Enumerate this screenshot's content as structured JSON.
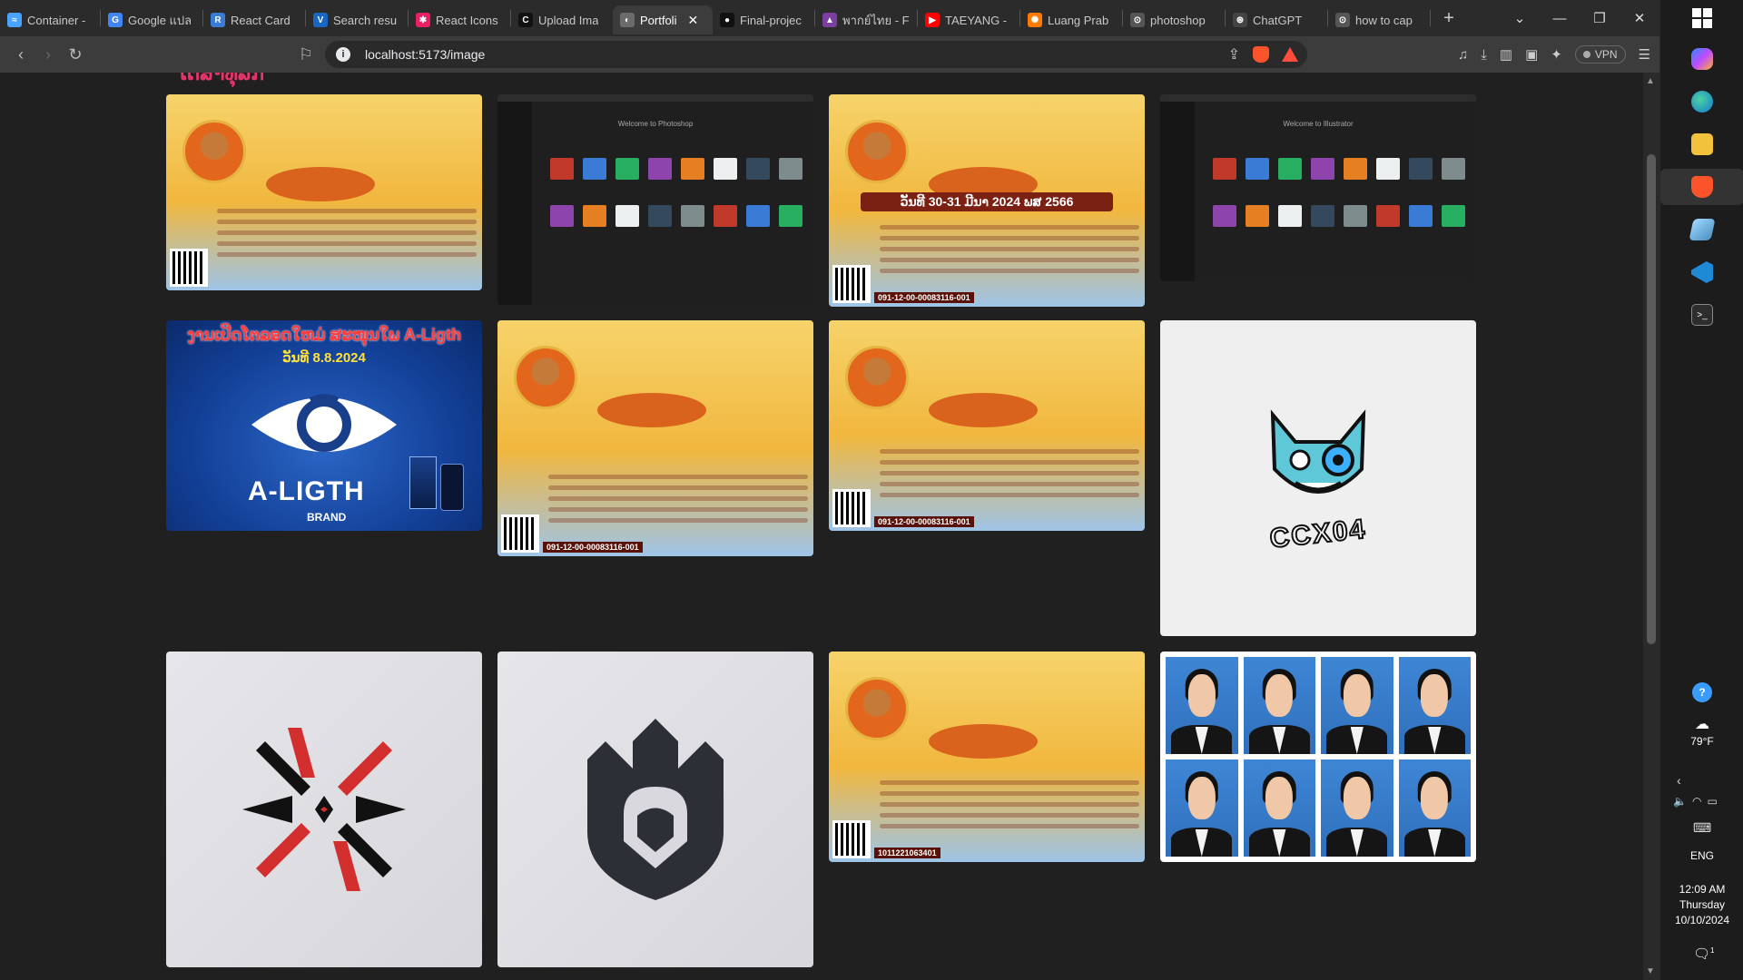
{
  "browser": {
    "tabs": [
      {
        "title": "Container -",
        "icon": "container-icon",
        "color": "#4aa3ff",
        "glyph": "≈"
      },
      {
        "title": "Google แปล",
        "icon": "google-translate-icon",
        "color": "#4285f4",
        "glyph": "G"
      },
      {
        "title": "React Card",
        "icon": "react-card-icon",
        "color": "#3a7bd5",
        "glyph": "R"
      },
      {
        "title": "Search resu",
        "icon": "vuetify-icon",
        "color": "#1867c0",
        "glyph": "V"
      },
      {
        "title": "React Icons",
        "icon": "react-icons-icon",
        "color": "#e91e63",
        "glyph": "✱"
      },
      {
        "title": "Upload Ima",
        "icon": "upload-icon",
        "color": "#111111",
        "glyph": "C"
      },
      {
        "title": "Portfoli",
        "icon": "portfolio-icon",
        "color": "#6b6b6b",
        "glyph": "◐",
        "active": true
      },
      {
        "title": "Final-projec",
        "icon": "github-icon",
        "color": "#111111",
        "glyph": "●"
      },
      {
        "title": "พากย์ไทย - F",
        "icon": "anime-icon",
        "color": "#7b3fa0",
        "glyph": "▲"
      },
      {
        "title": "TAEYANG -",
        "icon": "youtube-icon",
        "color": "#ff0000",
        "glyph": "▶"
      },
      {
        "title": "Luang Prab",
        "icon": "travel-icon",
        "color": "#ff7a00",
        "glyph": "✺"
      },
      {
        "title": "photoshop",
        "icon": "chatgpt-icon",
        "color": "#555555",
        "glyph": "⊙"
      },
      {
        "title": "ChatGPT",
        "icon": "chatgpt-icon",
        "color": "#444444",
        "glyph": "⊛"
      },
      {
        "title": "how to cap",
        "icon": "chatgpt-icon",
        "color": "#555555",
        "glyph": "⊙"
      }
    ],
    "new_tab": "+",
    "url": "localhost:5173/image",
    "vpn_label": "VPN"
  },
  "page": {
    "heading": "ໂຕສາທຸລກ",
    "images": [
      {
        "kind": "poster",
        "name": "poster-monk-ceremony"
      },
      {
        "kind": "screen",
        "name": "screenshot-photoshop-welcome",
        "label": "Welcome to Photoshop"
      },
      {
        "kind": "poster",
        "name": "poster-boun-pha-vet",
        "headline": "ວັນທີ 30-31 ມີນາ 2024 ພສ 2566",
        "code": "091-12-00-00083116-001"
      },
      {
        "kind": "screen",
        "name": "screenshot-illustrator-welcome",
        "label": "Welcome to Illustrator"
      },
      {
        "kind": "ad",
        "name": "ad-a-ligth",
        "title": "ງານເປີດໂຕລອດໃຫມ່ ສະໜຸນໃພ A-Ligth",
        "date": "ວັນທີ 8.8.2024",
        "brand": "A-LIGTH",
        "brand_sub": "BRAND"
      },
      {
        "kind": "poster",
        "name": "poster-ordination",
        "code": "091-12-00-00083116-001"
      },
      {
        "kind": "poster",
        "name": "poster-temple-festival",
        "code": "091-12-00-00083116-001"
      },
      {
        "kind": "logo",
        "name": "logo-ccx04",
        "text": "CCX04"
      },
      {
        "kind": "logo",
        "name": "logo-red-black-star"
      },
      {
        "kind": "logo",
        "name": "logo-dark-shield"
      },
      {
        "kind": "poster",
        "name": "poster-donation-list",
        "code": "1011221063401"
      },
      {
        "kind": "photos",
        "name": "id-photo-sheet"
      }
    ]
  },
  "taskbar": {
    "weather_temp": "79°F",
    "language": "ENG",
    "time": "12:09 AM",
    "day": "Thursday",
    "date": "10/10/2024",
    "notifications": "1"
  },
  "colors": {
    "accent_heading": "#e8346a",
    "chrome_bg": "#2b2b2b",
    "page_bg": "#202020"
  }
}
